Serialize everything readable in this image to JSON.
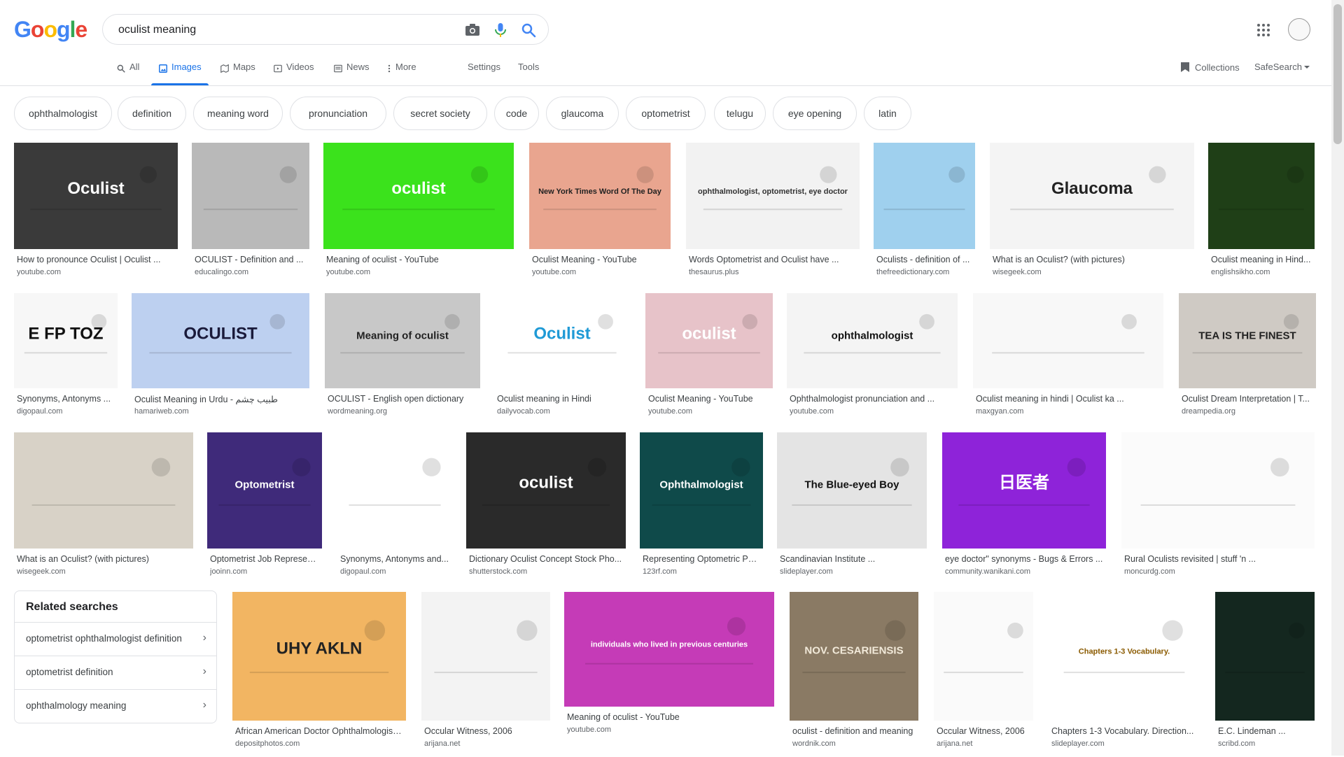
{
  "logo_text": [
    "G",
    "o",
    "o",
    "g",
    "l",
    "e"
  ],
  "logo_colors": [
    "#4285f4",
    "#ea4335",
    "#fbbc05",
    "#4285f4",
    "#34a853",
    "#ea4335"
  ],
  "search": {
    "query": "oculist meaning"
  },
  "tabs": [
    {
      "label": "All",
      "icon": "search-icon"
    },
    {
      "label": "Images",
      "icon": "image-icon",
      "active": true
    },
    {
      "label": "Maps",
      "icon": "map-icon"
    },
    {
      "label": "Videos",
      "icon": "video-icon"
    },
    {
      "label": "News",
      "icon": "news-icon"
    },
    {
      "label": "More",
      "icon": "more-vert-icon"
    }
  ],
  "tools": {
    "settings": "Settings",
    "tools": "Tools",
    "collections": "Collections",
    "safesearch": "SafeSearch"
  },
  "chips": [
    "ophthalmologist",
    "definition",
    "meaning word",
    "pronunciation",
    "secret society",
    "code",
    "glaucoma",
    "optometrist",
    "telugu",
    "eye opening",
    "latin"
  ],
  "images": [
    {
      "title": "How to pronounce Oculist | Oculist ...",
      "source": "youtube.com",
      "color": "#3a3a3a",
      "label": "Oculist",
      "label_color": "#ffffff"
    },
    {
      "title": "OCULIST - Definition and ...",
      "source": "educalingo.com",
      "color": "#b9b9b9",
      "label": "",
      "label_color": "#ffffff"
    },
    {
      "title": "Meaning of oculist - YouTube",
      "source": "youtube.com",
      "color": "#3be21c",
      "label": "oculist",
      "label_color": "#ffffff"
    },
    {
      "title": "Oculist Meaning - YouTube",
      "source": "youtube.com",
      "color": "#e9a58f",
      "label": "New York Times Word Of The Day",
      "label_color": "#222222"
    },
    {
      "title": "Words Optometrist and Oculist have ...",
      "source": "thesaurus.plus",
      "color": "#f2f2f2",
      "label": "ophthalmologist, optometrist, eye doctor",
      "label_color": "#333333"
    },
    {
      "title": "Oculists - definition of ...",
      "source": "thefreedictionary.com",
      "color": "#9fd0ee",
      "label": "",
      "label_color": "#ffffff"
    },
    {
      "title": "What is an Oculist? (with pictures)",
      "source": "wisegeek.com",
      "color": "#f4f4f4",
      "label": "Glaucoma",
      "label_color": "#222222"
    },
    {
      "title": "Oculist meaning in Hind...",
      "source": "englishsikho.com",
      "color": "#1f3f17",
      "label": "",
      "label_color": "#ffffff"
    },
    {
      "title": "Synonyms, Antonyms ...",
      "source": "digopaul.com",
      "color": "#f7f7f7",
      "label": "E FP TOZ",
      "label_color": "#111111"
    },
    {
      "title": "Oculist Meaning in Urdu - طبیب چشم",
      "source": "hamariweb.com",
      "color": "#bdd0f0",
      "label": "OCULIST",
      "label_color": "#1a1a3a"
    },
    {
      "title": "OCULIST - English open dictionary",
      "source": "wordmeaning.org",
      "color": "#c8c8c8",
      "label": "Meaning of oculist",
      "label_color": "#222222"
    },
    {
      "title": "Oculist meaning in Hindi",
      "source": "dailyvocab.com",
      "color": "#ffffff",
      "label": "Oculist",
      "label_color": "#1f9ad6"
    },
    {
      "title": "Oculist Meaning - YouTube",
      "source": "youtube.com",
      "color": "#e7c3c9",
      "label": "oculist",
      "label_color": "#ffffff"
    },
    {
      "title": "Ophthalmologist pronunciation and ...",
      "source": "youtube.com",
      "color": "#f4f4f4",
      "label": "ophthalmologist",
      "label_color": "#111111"
    },
    {
      "title": "Oculist meaning in hindi | Oculist ka ...",
      "source": "maxgyan.com",
      "color": "#f8f8f8",
      "label": "",
      "label_color": "#333333"
    },
    {
      "title": "Oculist Dream Interpretation | T...",
      "source": "dreampedia.org",
      "color": "#cfcac4",
      "label": "TEA IS THE FINEST",
      "label_color": "#222222"
    },
    {
      "title": "What is an Oculist? (with pictures)",
      "source": "wisegeek.com",
      "color": "#d8d2c7",
      "label": "",
      "label_color": "#ffffff"
    },
    {
      "title": "Optometrist Job Represen...",
      "source": "jooinn.com",
      "color": "#3f2a7a",
      "label": "Optometrist",
      "label_color": "#ffffff"
    },
    {
      "title": "Synonyms, Antonyms and...",
      "source": "digopaul.com",
      "color": "#ffffff",
      "label": "",
      "label_color": "#111111"
    },
    {
      "title": "Dictionary Oculist Concept Stock Pho...",
      "source": "shutterstock.com",
      "color": "#2a2a2a",
      "label": "oculist",
      "label_color": "#ffffff"
    },
    {
      "title": "Representing Optometric Ph...",
      "source": "123rf.com",
      "color": "#0f4a4a",
      "label": "Ophthalmologist",
      "label_color": "#ffffff"
    },
    {
      "title": "Scandinavian Institute ...",
      "source": "slideplayer.com",
      "color": "#e4e4e4",
      "label": "The Blue-eyed Boy",
      "label_color": "#111111"
    },
    {
      "title": "eye doctor\" synonyms - Bugs & Errors ...",
      "source": "community.wanikani.com",
      "color": "#8e23d9",
      "label": "日医者",
      "label_color": "#ffffff"
    },
    {
      "title": "Rural Oculists revisited | stuff 'n ...",
      "source": "moncurdg.com",
      "color": "#fbfbfb",
      "label": "",
      "label_color": "#333333"
    },
    {
      "title": "African American Doctor Ophthalmologist ...",
      "source": "depositphotos.com",
      "color": "#f2b562",
      "label": "UHY AKLN",
      "label_color": "#222222"
    },
    {
      "title": "Occular Witness, 2006",
      "source": "arijana.net",
      "color": "#f3f3f3",
      "label": "",
      "label_color": "#222222"
    },
    {
      "title": "Meaning of oculist - YouTube",
      "source": "youtube.com",
      "color": "#c53bb7",
      "label": "individuals who lived in previous centuries",
      "label_color": "#ffffff"
    },
    {
      "title": "oculist - definition and meaning",
      "source": "wordnik.com",
      "color": "#8a7a64",
      "label": "NOV. CESARIENSIS",
      "label_color": "#f1e9d9"
    },
    {
      "title": "Occular Witness, 2006",
      "source": "arijana.net",
      "color": "#fafafa",
      "label": "",
      "label_color": "#222222"
    },
    {
      "title": "Chapters 1-3 Vocabulary. Direction...",
      "source": "slideplayer.com",
      "color": "#ffffff",
      "label": "Chapters 1-3 Vocabulary.",
      "label_color": "#8a5a00"
    },
    {
      "title": "E.C. Lindeman ...",
      "source": "scribd.com",
      "color": "#14271f",
      "label": "",
      "label_color": "#ffffff"
    }
  ],
  "related": {
    "title": "Related searches",
    "items": [
      "optometrist ophthalmologist definition",
      "optometrist definition",
      "ophthalmology meaning"
    ]
  }
}
